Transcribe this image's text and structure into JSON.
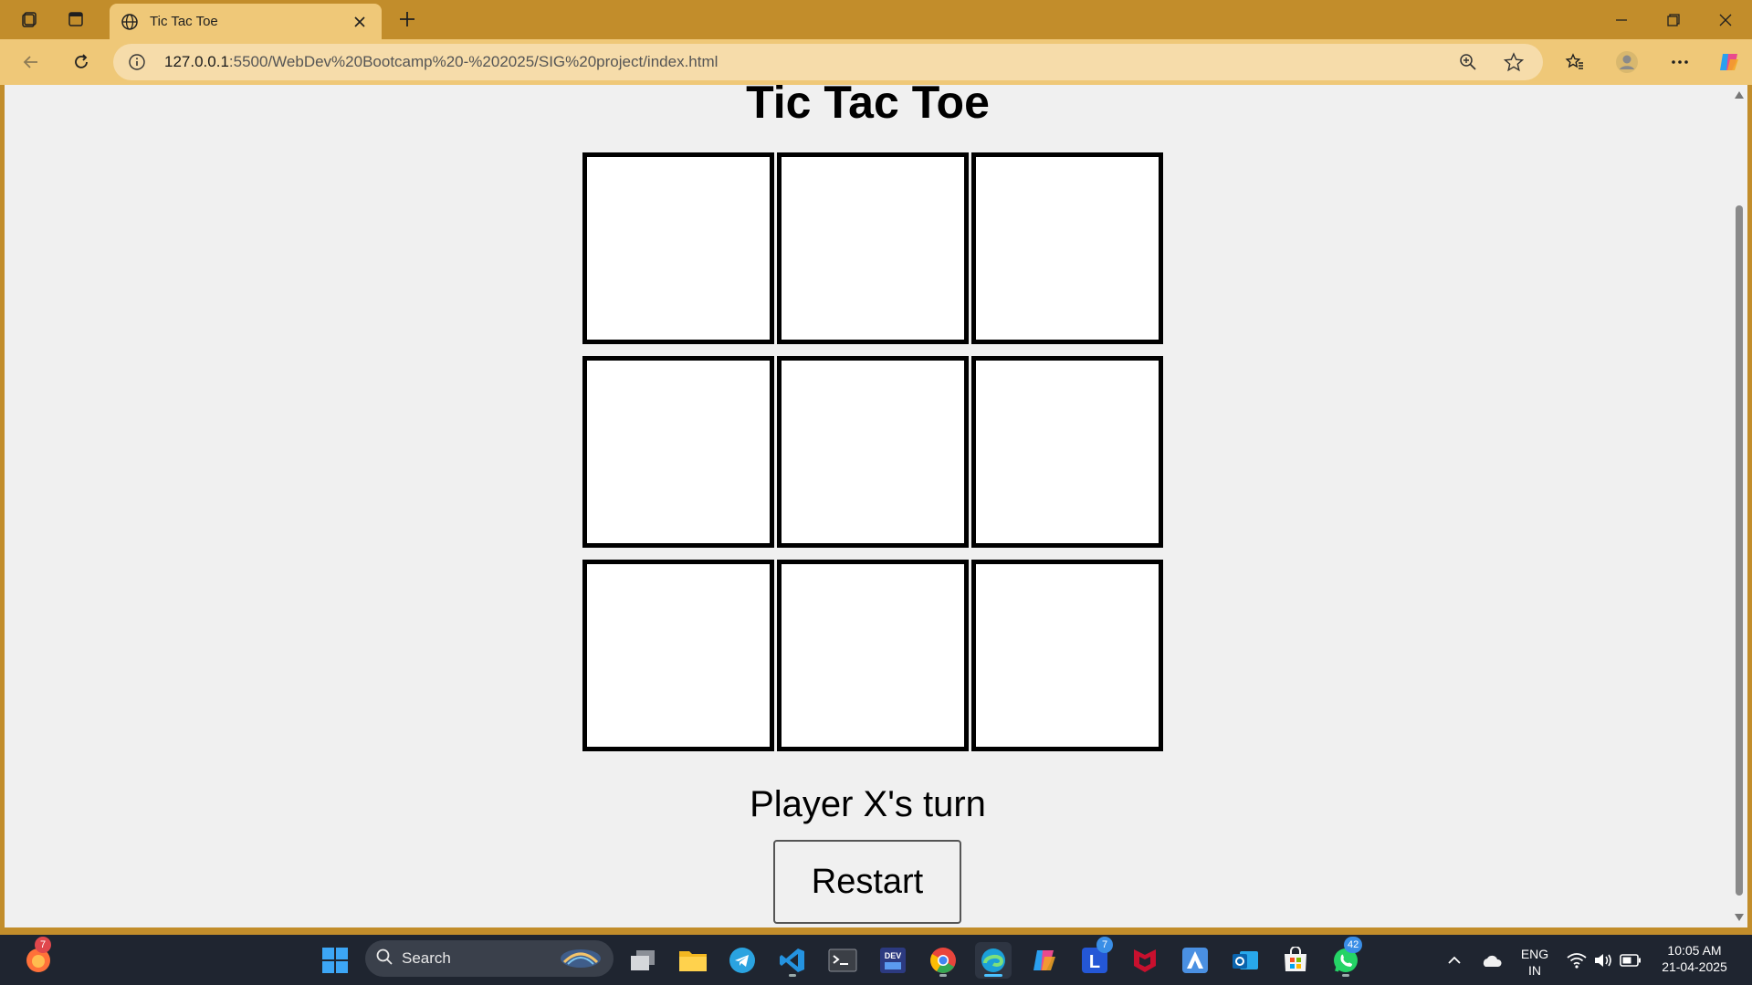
{
  "browser": {
    "tab_title": "Tic Tac Toe",
    "url_host": "127.0.0.1",
    "url_rest": ":5500/WebDev%20Bootcamp%20-%202025/SIG%20project/index.html"
  },
  "page": {
    "title": "Tic Tac Toe",
    "board": [
      "",
      "",
      "",
      "",
      "",
      "",
      "",
      "",
      ""
    ],
    "status": "Player X's turn",
    "restart_label": "Restart"
  },
  "taskbar": {
    "search_placeholder": "Search",
    "firefox_badge": "7",
    "l_app_badge": "7",
    "whatsapp_badge": "42",
    "lang_top": "ENG",
    "lang_bottom": "IN",
    "time": "10:05 AM",
    "date": "21-04-2025"
  },
  "colors": {
    "frame": "#c28d2b",
    "toolbar": "#efc878",
    "page_bg": "#f0f0f0",
    "taskbar": "#1f2530"
  }
}
